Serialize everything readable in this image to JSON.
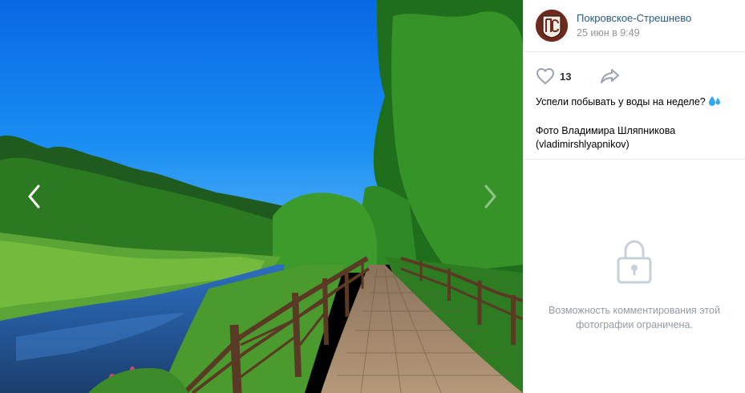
{
  "post": {
    "author": "Покровское-Стрешнево",
    "date": "25 июн в 9:49",
    "likes": "13",
    "caption_line1": "Успели побывать у воды на неделе?",
    "credit_line1": "Фото Владимира Шляпникова",
    "credit_line2": "(vladimirshlyapnikov)"
  },
  "comments": {
    "closed_line1": "Возможность комментирования этой",
    "closed_line2": "фотографии ограничена."
  },
  "icons": {
    "prev": "chevron-left-icon",
    "next": "chevron-right-icon",
    "like": "heart-icon",
    "share": "share-arrow-icon",
    "lock": "lock-icon",
    "emoji": "sweat-droplets-emoji"
  },
  "colors": {
    "link": "#2a5885",
    "muted": "#939393",
    "sky": "#0d7ff0"
  }
}
